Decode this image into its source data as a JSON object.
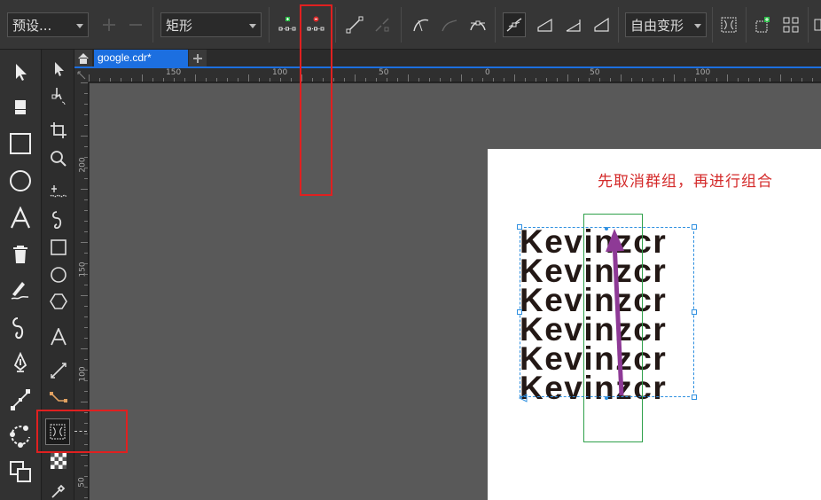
{
  "propbar": {
    "preset_select": "预设...",
    "shape_select": "矩形",
    "transform_select": "自由变形"
  },
  "tabs": {
    "document_tab": "google.cdr*"
  },
  "rulers": {
    "horizontal_labels": [
      "150",
      "100",
      "50",
      "0",
      "50",
      "100"
    ],
    "vertical_labels": [
      "200",
      "150",
      "100",
      "50"
    ]
  },
  "canvas": {
    "annotation": "先取消群组，再进行组合",
    "text_lines": [
      "Kevinzcr",
      "Kevinzcr",
      "Kevinzcr",
      "Kevinzcr",
      "Kevinzcr",
      "Kevinzcr"
    ]
  },
  "colors": {
    "accent_blue": "#1c6fe0",
    "annotation_red": "#d42a2a",
    "highlight_red": "#e02020",
    "arrow_purple": "#8e3a96",
    "guide_green": "#2ea04a"
  }
}
